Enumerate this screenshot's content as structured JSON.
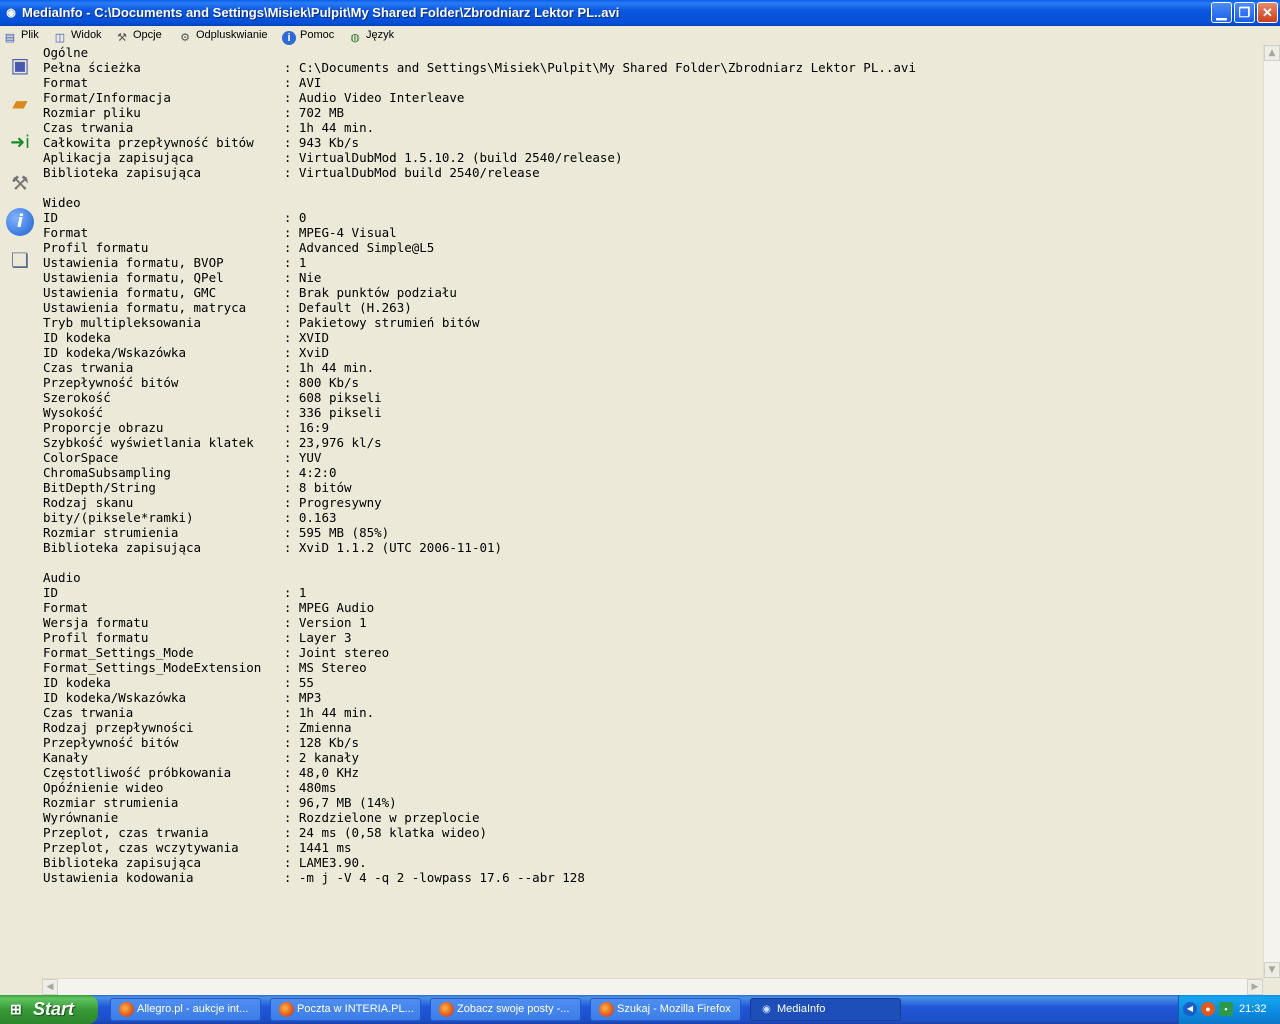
{
  "window": {
    "title": "MediaInfo - C:\\Documents and Settings\\Misiek\\Pulpit\\My Shared Folder\\Zbrodniarz Lektor PL..avi"
  },
  "menu": {
    "plik": "Plik",
    "widok": "Widok",
    "opcje": "Opcje",
    "odpluskwianie": "Odpluskwianie",
    "pomoc": "Pomoc",
    "jezyk": "Język"
  },
  "toolbar": [
    "open-file-icon",
    "open-folder-icon",
    "export-icon",
    "preferences-icon",
    "about-icon",
    "copy-icon"
  ],
  "info": {
    "general": {
      "heading": "Ogólne",
      "rows": [
        {
          "k": "Pełna ścieżka",
          "v": "C:\\Documents and Settings\\Misiek\\Pulpit\\My Shared Folder\\Zbrodniarz Lektor PL..avi"
        },
        {
          "k": "Format",
          "v": "AVI"
        },
        {
          "k": "Format/Informacja",
          "v": "Audio Video Interleave"
        },
        {
          "k": "Rozmiar pliku",
          "v": "702 MB"
        },
        {
          "k": "Czas trwania",
          "v": "1h 44 min."
        },
        {
          "k": "Całkowita przepływność bitów",
          "v": "943 Kb/s"
        },
        {
          "k": "Aplikacja zapisująca",
          "v": "VirtualDubMod 1.5.10.2 (build 2540/release)"
        },
        {
          "k": "Biblioteka zapisująca",
          "v": "VirtualDubMod build 2540/release"
        }
      ]
    },
    "video": {
      "heading": "Wideo",
      "rows": [
        {
          "k": "ID",
          "v": "0"
        },
        {
          "k": "Format",
          "v": "MPEG-4 Visual"
        },
        {
          "k": "Profil formatu",
          "v": "Advanced Simple@L5"
        },
        {
          "k": "Ustawienia formatu, BVOP",
          "v": "1"
        },
        {
          "k": "Ustawienia formatu, QPel",
          "v": "Nie"
        },
        {
          "k": "Ustawienia formatu, GMC",
          "v": "Brak punktów podziału"
        },
        {
          "k": "Ustawienia formatu, matryca",
          "v": "Default (H.263)"
        },
        {
          "k": "Tryb multipleksowania",
          "v": "Pakietowy strumień bitów"
        },
        {
          "k": "ID kodeka",
          "v": "XVID"
        },
        {
          "k": "ID kodeka/Wskazówka",
          "v": "XviD"
        },
        {
          "k": "Czas trwania",
          "v": "1h 44 min."
        },
        {
          "k": "Przepływność bitów",
          "v": "800 Kb/s"
        },
        {
          "k": "Szerokość",
          "v": "608 pikseli"
        },
        {
          "k": "Wysokość",
          "v": "336 pikseli"
        },
        {
          "k": "Proporcje obrazu",
          "v": "16:9"
        },
        {
          "k": "Szybkość wyświetlania klatek",
          "v": "23,976 kl/s"
        },
        {
          "k": "ColorSpace",
          "v": "YUV"
        },
        {
          "k": "ChromaSubsampling",
          "v": "4:2:0"
        },
        {
          "k": "BitDepth/String",
          "v": "8 bitów"
        },
        {
          "k": "Rodzaj skanu",
          "v": "Progresywny"
        },
        {
          "k": "bity/(piksele*ramki)",
          "v": "0.163"
        },
        {
          "k": "Rozmiar strumienia",
          "v": "595 MB (85%)"
        },
        {
          "k": "Biblioteka zapisująca",
          "v": "XviD 1.1.2 (UTC 2006-11-01)"
        }
      ]
    },
    "audio": {
      "heading": "Audio",
      "rows": [
        {
          "k": "ID",
          "v": "1"
        },
        {
          "k": "Format",
          "v": "MPEG Audio"
        },
        {
          "k": "Wersja formatu",
          "v": "Version 1"
        },
        {
          "k": "Profil formatu",
          "v": "Layer 3"
        },
        {
          "k": "Format_Settings_Mode",
          "v": "Joint stereo"
        },
        {
          "k": "Format_Settings_ModeExtension",
          "v": "MS Stereo"
        },
        {
          "k": "ID kodeka",
          "v": "55"
        },
        {
          "k": "ID kodeka/Wskazówka",
          "v": "MP3"
        },
        {
          "k": "Czas trwania",
          "v": "1h 44 min."
        },
        {
          "k": "Rodzaj przepływności",
          "v": "Zmienna"
        },
        {
          "k": "Przepływność bitów",
          "v": "128 Kb/s"
        },
        {
          "k": "Kanały",
          "v": "2 kanały"
        },
        {
          "k": "Częstotliwość próbkowania",
          "v": "48,0 KHz"
        },
        {
          "k": "Opóźnienie wideo",
          "v": "480ms"
        },
        {
          "k": "Rozmiar strumienia",
          "v": "96,7 MB (14%)"
        },
        {
          "k": "Wyrównanie",
          "v": "Rozdzielone w przeplocie"
        },
        {
          "k": "Przeplot, czas trwania",
          "v": "24 ms (0,58 klatka wideo)"
        },
        {
          "k": "Przeplot, czas wczytywania",
          "v": "1441 ms"
        },
        {
          "k": "Biblioteka zapisująca",
          "v": "LAME3.90."
        },
        {
          "k": "Ustawienia kodowania",
          "v": "-m j -V 4 -q 2 -lowpass 17.6 --abr 128"
        }
      ]
    }
  },
  "taskbar": {
    "start": "Start",
    "tasks": [
      {
        "label": "Allegro.pl - aukcje int...",
        "icon": "firefox-icon",
        "active": false
      },
      {
        "label": "Poczta w INTERIA.PL...",
        "icon": "firefox-icon",
        "active": false
      },
      {
        "label": "Zobacz swoje posty -...",
        "icon": "firefox-icon",
        "active": false
      },
      {
        "label": "Szukaj - Mozilla Firefox",
        "icon": "firefox-icon",
        "active": false
      },
      {
        "label": "MediaInfo",
        "icon": "mediainfo-icon",
        "active": true
      }
    ],
    "clock": "21:32"
  }
}
